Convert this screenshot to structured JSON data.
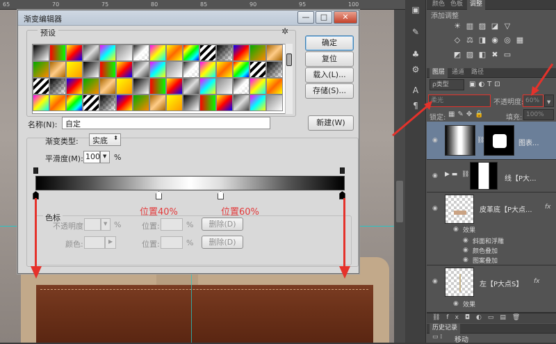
{
  "canvas": {
    "ruler_ticks": [
      "65",
      "70",
      "75",
      "80",
      "85",
      "90",
      "95",
      "100"
    ]
  },
  "dialog": {
    "title": "渐变编辑器",
    "win_min": "—",
    "win_max": "□",
    "win_close": "✕",
    "presets_label": "预设",
    "gear": "✲",
    "buttons": {
      "ok": "确定",
      "reset": "复位",
      "load": "载入(L)...",
      "save": "存储(S)...",
      "new": "新建(W)"
    },
    "name_label": "名称(N):",
    "name_value": "自定",
    "grad_type_label": "渐变类型:",
    "grad_type_value": "实底",
    "smooth_label": "平滑度(M):",
    "smooth_value": "100",
    "percent": "%",
    "stops_group": "色标",
    "opacity_label": "不透明度:",
    "location_label": "位置:",
    "delete_label": "删除(D)",
    "color_label": "颜色:",
    "annot_40": "位置40%",
    "annot_60": "位置60%"
  },
  "panel": {
    "top_tabs": [
      "颜色",
      "色板",
      "调整"
    ],
    "add_adjust": "添加调整",
    "layer_tabs": [
      "图层",
      "通道",
      "路径"
    ],
    "kind_filter": "ρ类型",
    "blend_mode": "柔光",
    "opacity_label": "不透明度:",
    "opacity_value": "60%",
    "lock_label": "锁定:",
    "fill_label": "填充:",
    "fill_value": "100%",
    "layers": [
      {
        "name": "图表...",
        "selected": true
      },
      {
        "name": "线【P大...",
        "group": true
      },
      {
        "name": "皮革底【P大点...",
        "fx": "fx"
      },
      {
        "name": "左【P大点S】",
        "fx": "fx"
      }
    ],
    "effects_label": "效果",
    "effects": [
      "斜面和浮雕",
      "颜色叠加",
      "图案叠加"
    ],
    "effects2_label": "效果",
    "history_tab": "历史记录",
    "history_item": "移动"
  }
}
